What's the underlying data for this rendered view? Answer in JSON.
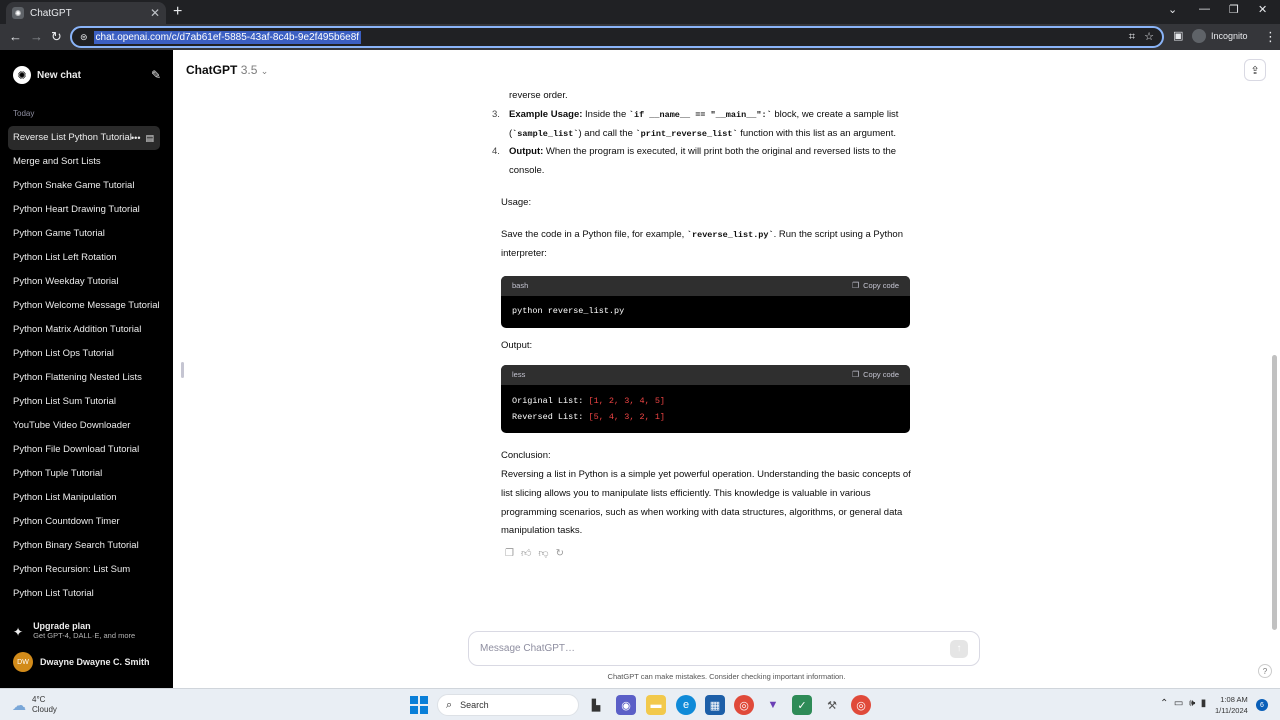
{
  "browser": {
    "tab_title": "ChatGPT",
    "url": "chat.openai.com/c/d7ab61ef-5885-43af-8c4b-9e2f495b6e8f",
    "incognito_label": "Incognito"
  },
  "sidebar": {
    "new_chat_label": "New chat",
    "section_label": "Today",
    "items": [
      "Reverse List Python Tutorial",
      "Merge and Sort Lists",
      "Python Snake Game Tutorial",
      "Python Heart Drawing Tutorial",
      "Python Game Tutorial",
      "Python List Left Rotation",
      "Python Weekday Tutorial",
      "Python Welcome Message Tutorial",
      "Python Matrix Addition Tutorial",
      "Python List Ops Tutorial",
      "Python Flattening Nested Lists",
      "Python List Sum Tutorial",
      "YouTube Video Downloader",
      "Python File Download Tutorial",
      "Python Tuple Tutorial",
      "Python List Manipulation",
      "Python Countdown Timer",
      "Python Binary Search Tutorial",
      "Python Recursion: List Sum",
      "Python List Tutorial"
    ],
    "upgrade_title": "Upgrade plan",
    "upgrade_subtitle": "Get GPT-4, DALL·E, and more",
    "user_initials": "DW",
    "user_name": "Dwayne Dwayne C. Smith"
  },
  "header": {
    "model_name": "ChatGPT",
    "model_version": "3.5"
  },
  "message": {
    "cont_line": "reverse order.",
    "item3_num": "3.",
    "item3_title": "Example Usage:",
    "item3_t1": " Inside the ",
    "item3_code1": "`if __name__ == \"__main__\":`",
    "item3_t2": " block, we create a sample list (",
    "item3_code2": "`sample_list`",
    "item3_t3": ") and call the ",
    "item3_code3": "`print_reverse_list`",
    "item3_t4": " function with this list as an argument.",
    "item4_num": "4.",
    "item4_title": "Output:",
    "item4_text": " When the program is executed, it will print both the original and reversed lists to the console.",
    "usage_heading": "Usage:",
    "usage_t1": "Save the code in a Python file, for example, ",
    "usage_code": "`reverse_list.py`",
    "usage_t2": ". Run the script using a Python interpreter:",
    "code1_lang": "bash",
    "copy_label": "Copy code",
    "code1_line": "python reverse_list.py",
    "output_heading": "Output:",
    "code2_lang": "less",
    "code2_l1_label": "Original List: ",
    "code2_l1_value": "[1, 2, 3, 4, 5]",
    "code2_l2_label": "Reversed List: ",
    "code2_l2_value": "[5, 4, 3, 2, 1]",
    "conclusion_heading": "Conclusion:",
    "conclusion_text": "Reversing a list in Python is a simple yet powerful operation. Understanding the basic concepts of list slicing allows you to manipulate lists efficiently. This knowledge is valuable in various programming scenarios, such as when working with data structures, algorithms, or general data manipulation tasks."
  },
  "composer": {
    "placeholder": "Message ChatGPT…",
    "disclaimer": "ChatGPT can make mistakes. Consider checking important information."
  },
  "taskbar": {
    "temperature": "4°C",
    "weather": "Cloudy",
    "search_label": "Search",
    "time": "1:08 AM",
    "date": "1/11/2024",
    "notification_count": "6"
  },
  "colors": {
    "omnibox_focus": "#8ab4f8",
    "sidebar_bg": "#000000",
    "code_value": "#ef4444",
    "avatar": "#d28b1a"
  }
}
